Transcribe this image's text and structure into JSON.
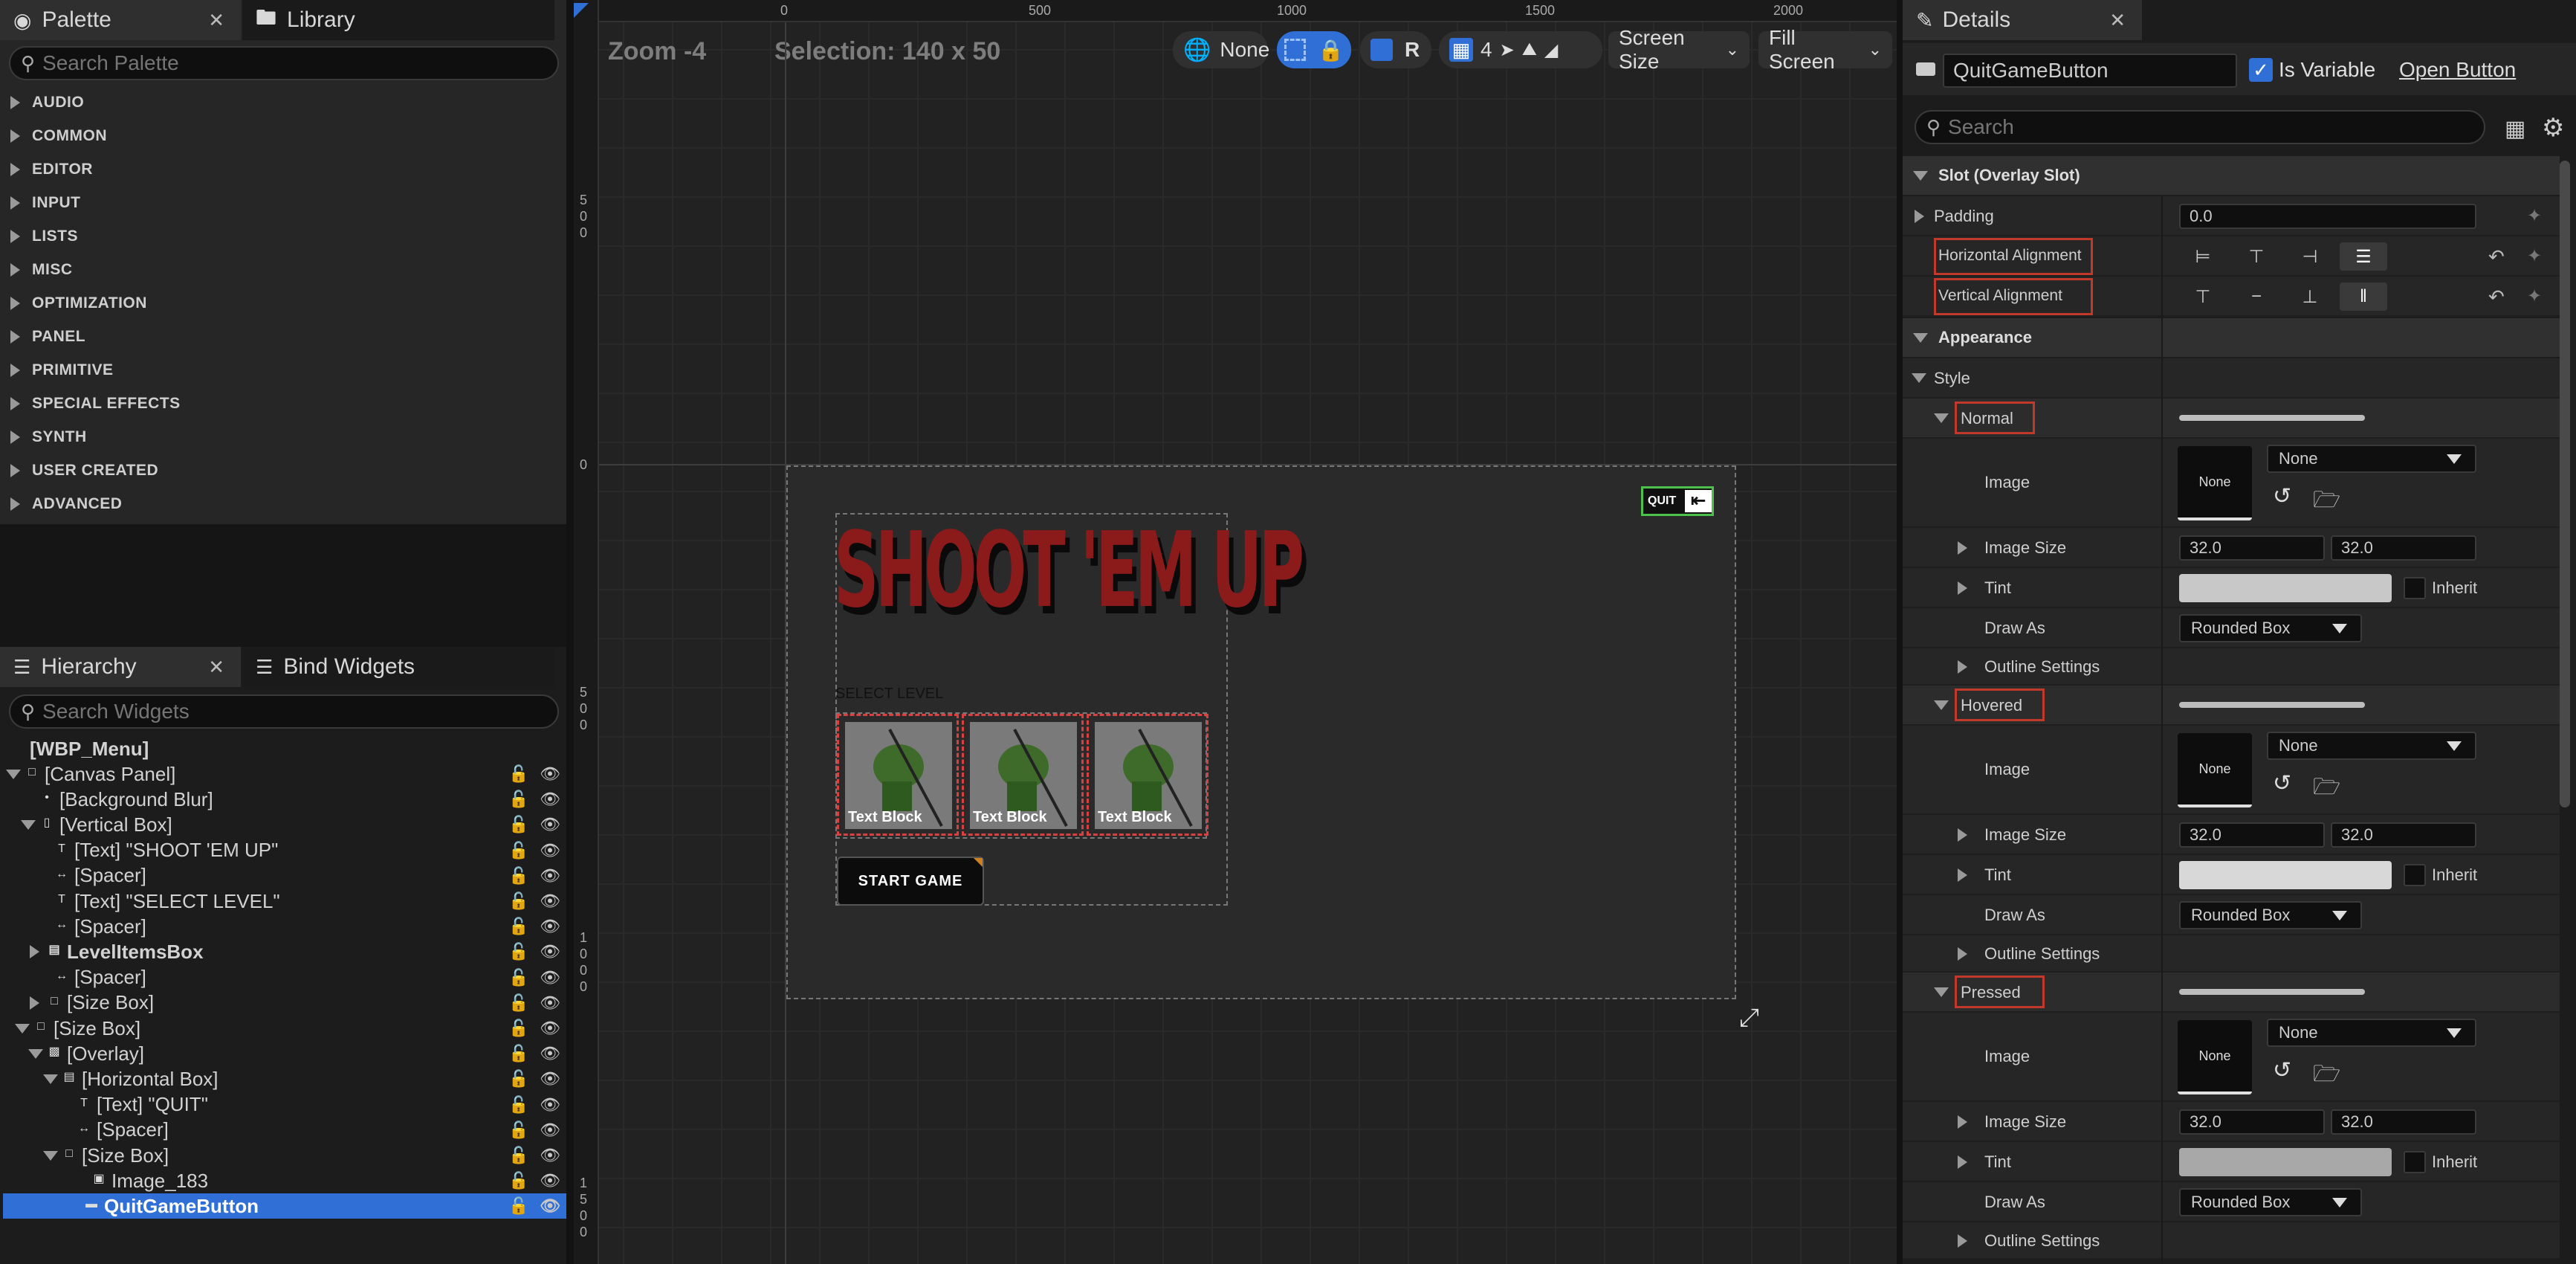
{
  "palette": {
    "tab_label": "Palette",
    "library_label": "Library",
    "search_placeholder": "Search Palette",
    "categories": [
      "AUDIO",
      "COMMON",
      "EDITOR",
      "INPUT",
      "LISTS",
      "MISC",
      "OPTIMIZATION",
      "PANEL",
      "PRIMITIVE",
      "SPECIAL EFFECTS",
      "SYNTH",
      "USER CREATED",
      "ADVANCED"
    ]
  },
  "hierarchy": {
    "tab_label": "Hierarchy",
    "bind_label": "Bind Widgets",
    "search_placeholder": "Search Widgets",
    "root": "[WBP_Menu]",
    "items": [
      {
        "label": "[Canvas Panel]"
      },
      {
        "label": "[Background Blur]"
      },
      {
        "label": "[Vertical Box]"
      },
      {
        "label": "[Text] \"SHOOT 'EM UP\""
      },
      {
        "label": "[Spacer]"
      },
      {
        "label": "[Text] \"SELECT LEVEL\""
      },
      {
        "label": "[Spacer]"
      },
      {
        "label": "LevelItemsBox"
      },
      {
        "label": "[Spacer]"
      },
      {
        "label": "[Size Box]"
      },
      {
        "label": "[Size Box]"
      },
      {
        "label": "[Overlay]"
      },
      {
        "label": "[Horizontal Box]"
      },
      {
        "label": "[Text] \"QUIT\""
      },
      {
        "label": "[Spacer]"
      },
      {
        "label": "[Size Box]"
      },
      {
        "label": "Image_183"
      },
      {
        "label": "QuitGameButton"
      }
    ]
  },
  "viewport": {
    "zoom": "Zoom -4",
    "selection": "Selection: 140 x 50",
    "none_label": "None",
    "r_label": "R",
    "grid_value": "4",
    "screen_size": "Screen Size",
    "fill_screen": "Fill Screen",
    "ruler_top": [
      "0",
      "500",
      "1000",
      "1500",
      "2000"
    ],
    "ruler_left": [
      "500",
      "0",
      "500",
      "1000",
      "1500"
    ]
  },
  "canvas": {
    "title": "SHOOT 'EM UP",
    "select_level": "SELECT LEVEL",
    "level_items": [
      "Text Block",
      "Text Block",
      "Text Block"
    ],
    "start_game": "START GAME",
    "quit": "QUIT"
  },
  "details": {
    "tab_label": "Details",
    "widget_name": "QuitGameButton",
    "is_variable_label": "Is Variable",
    "open_button_label": "Open Button",
    "search_placeholder": "Search",
    "slot_section": "Slot (Overlay Slot)",
    "padding_label": "Padding",
    "padding_value": "0.0",
    "h_align_label": "Horizontal Alignment",
    "v_align_label": "Vertical Alignment",
    "appearance_section": "Appearance",
    "style_label": "Style",
    "states": [
      {
        "name": "Normal",
        "image_label": "Image",
        "image_value": "None",
        "thumb_label": "None",
        "size_label": "Image Size",
        "size_x": "32.0",
        "size_y": "32.0",
        "tint_label": "Tint",
        "tint_color": "#c8c8c8",
        "inherit_label": "Inherit",
        "draw_as_label": "Draw As",
        "draw_as_value": "Rounded Box",
        "outline_label": "Outline Settings"
      },
      {
        "name": "Hovered",
        "image_label": "Image",
        "image_value": "None",
        "thumb_label": "None",
        "size_label": "Image Size",
        "size_x": "32.0",
        "size_y": "32.0",
        "tint_label": "Tint",
        "tint_color": "#d8d8d8",
        "inherit_label": "Inherit",
        "draw_as_label": "Draw As",
        "draw_as_value": "Rounded Box",
        "outline_label": "Outline Settings"
      },
      {
        "name": "Pressed",
        "image_label": "Image",
        "image_value": "None",
        "thumb_label": "None",
        "size_label": "Image Size",
        "size_x": "32.0",
        "size_y": "32.0",
        "tint_label": "Tint",
        "tint_color": "#a8a8a8",
        "inherit_label": "Inherit",
        "draw_as_label": "Draw As",
        "draw_as_value": "Rounded Box",
        "outline_label": "Outline Settings"
      }
    ]
  },
  "colors": {
    "accent": "#2f6fd6",
    "highlight": "#c0392b",
    "title_red": "#8b1a1a"
  }
}
